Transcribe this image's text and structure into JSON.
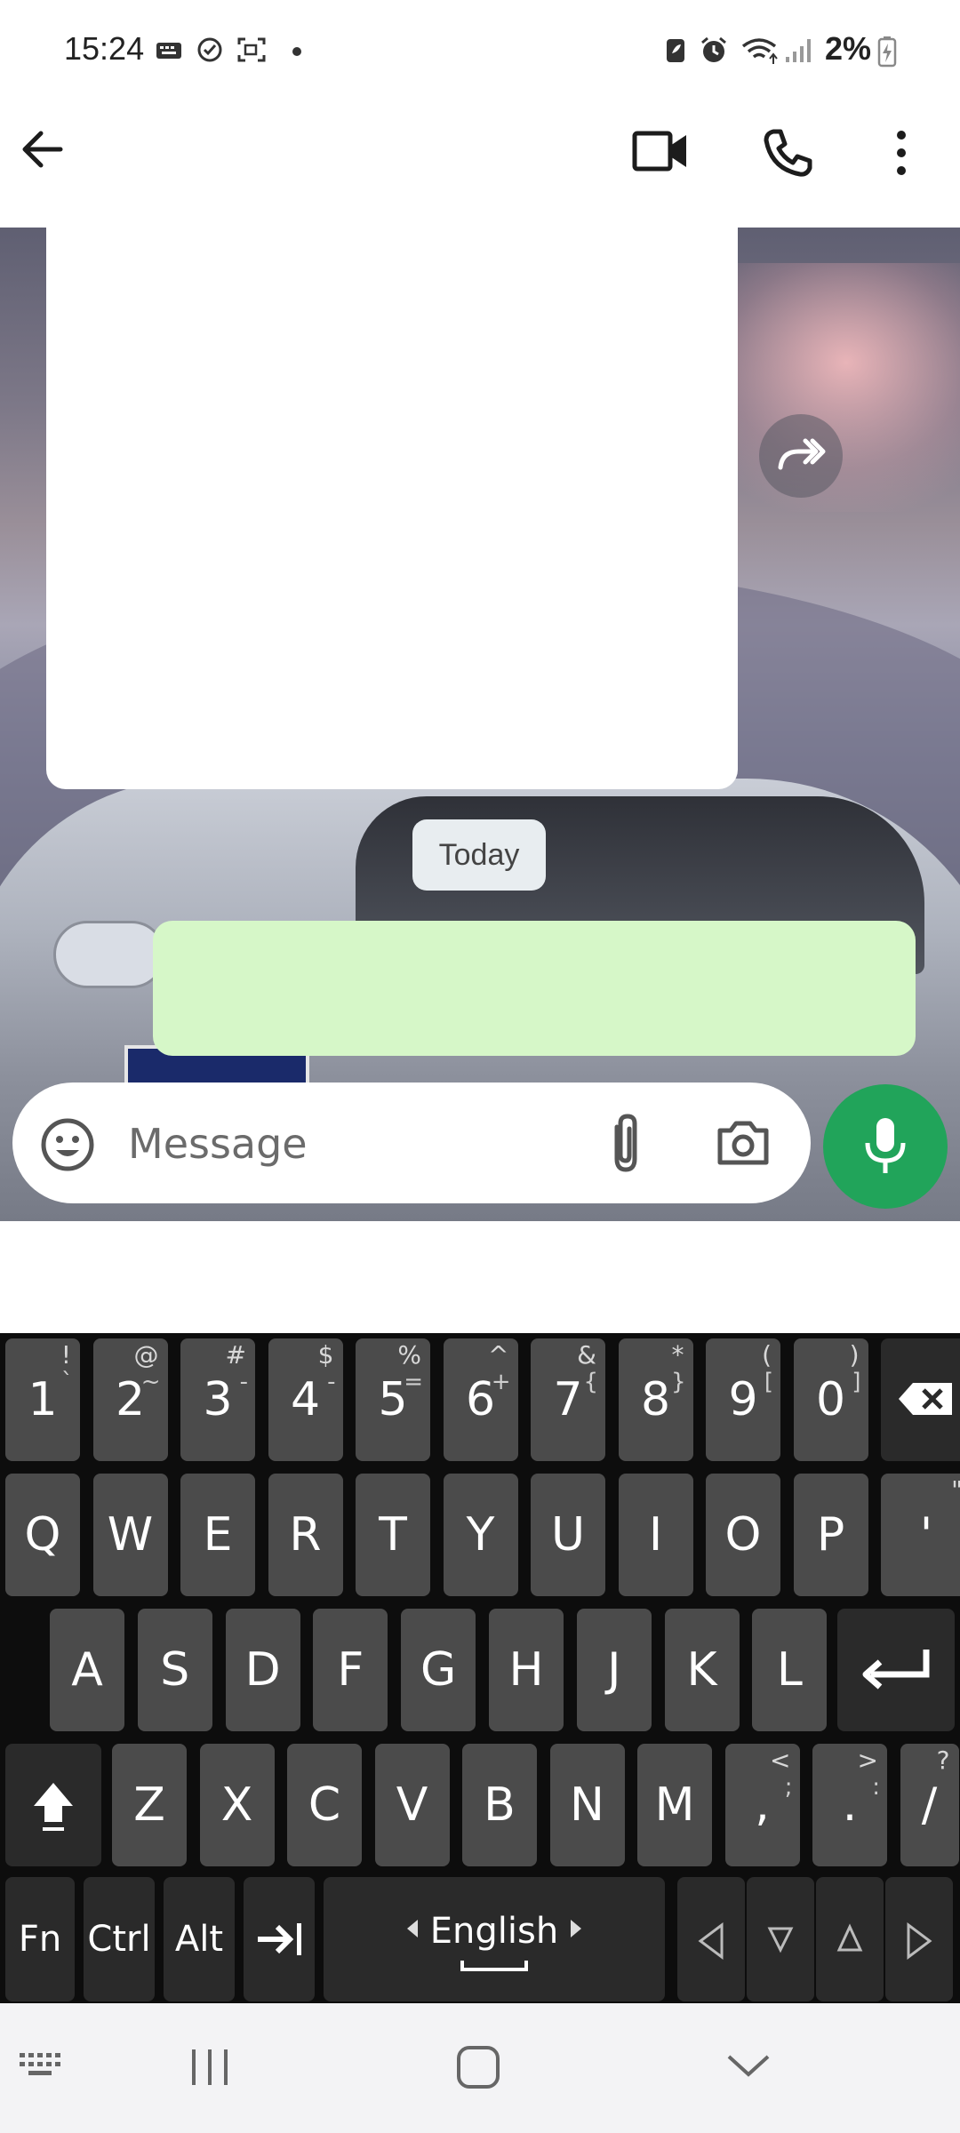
{
  "status_bar": {
    "time": "15:24",
    "battery_percent": "2%",
    "icons": [
      "keyboard-icon",
      "check-circle-icon",
      "screenshot-icon",
      "dot-icon",
      "battery-saver-icon",
      "alarm-icon",
      "wifi-icon",
      "signal-icon",
      "battery-charging-icon"
    ]
  },
  "app_bar": {
    "back_icon": "arrow-back-icon",
    "actions": [
      "video-call-icon",
      "phone-icon",
      "more-vert-icon"
    ]
  },
  "chat": {
    "date_chip": "Today",
    "forward_icon": "forward-icon"
  },
  "composer": {
    "placeholder": "Message",
    "icons": [
      "emoji-icon",
      "attach-icon",
      "camera-icon",
      "mic-icon"
    ]
  },
  "keyboard": {
    "number_row": [
      {
        "main": "1",
        "alt": "!",
        "alt2": "`"
      },
      {
        "main": "2",
        "alt": "@",
        "alt2": "~"
      },
      {
        "main": "3",
        "alt": "#",
        "alt2": "-"
      },
      {
        "main": "4",
        "alt": "$",
        "alt2": "-"
      },
      {
        "main": "5",
        "alt": "%",
        "alt2": "="
      },
      {
        "main": "6",
        "alt": "^",
        "alt2": "+"
      },
      {
        "main": "7",
        "alt": "&",
        "alt2": "{"
      },
      {
        "main": "8",
        "alt": "*",
        "alt2": "}"
      },
      {
        "main": "9",
        "alt": "(",
        "alt2": "["
      },
      {
        "main": "0",
        "alt": ")",
        "alt2": "]"
      }
    ],
    "row_q": [
      "Q",
      "W",
      "E",
      "R",
      "T",
      "Y",
      "U",
      "I",
      "O",
      "P"
    ],
    "row_q_last": {
      "main": "'",
      "alt": "\""
    },
    "row_a": [
      "A",
      "S",
      "D",
      "F",
      "G",
      "H",
      "J",
      "K",
      "L"
    ],
    "row_z": [
      "Z",
      "X",
      "C",
      "V",
      "B",
      "N",
      "M"
    ],
    "comma": {
      "main": ",",
      "alt": "<",
      "alt2": ";"
    },
    "period": {
      "main": ".",
      "alt": ">",
      "alt2": ":"
    },
    "slash": {
      "main": "/",
      "alt": "?"
    },
    "bottom": {
      "fn": "Fn",
      "ctrl": "Ctrl",
      "alt": "Alt",
      "language": "English"
    }
  },
  "nav_bar": {
    "icons": [
      "keyboard-toggle-icon",
      "recents-icon",
      "home-icon",
      "chevron-down-icon"
    ]
  }
}
